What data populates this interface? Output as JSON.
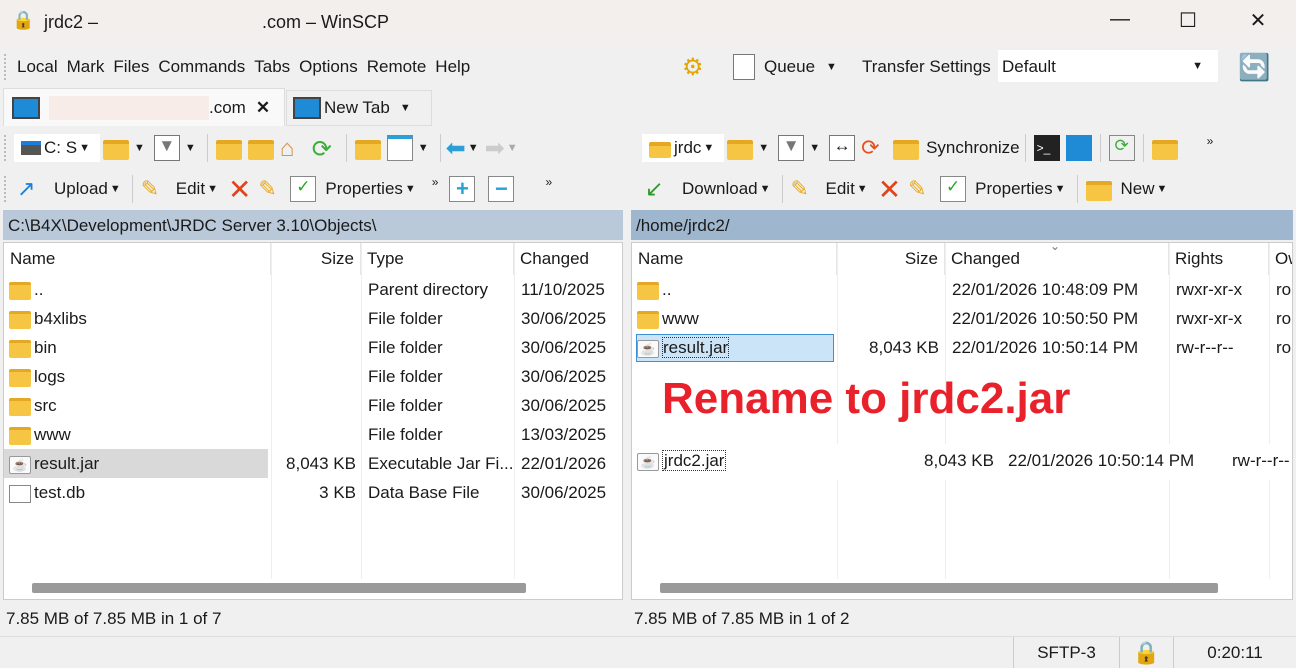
{
  "title": {
    "prefix": "jrdc2 –",
    "suffix": ".com – WinSCP"
  },
  "menu": [
    "Local",
    "Mark",
    "Files",
    "Commands",
    "Tabs",
    "Options",
    "Remote",
    "Help"
  ],
  "toolbar": {
    "queue": "Queue",
    "transfer_settings": "Transfer Settings",
    "transfer_value": "Default"
  },
  "tabs": {
    "session_suffix": ".com",
    "new_tab": "New Tab"
  },
  "left": {
    "drive": "C: S",
    "upload": "Upload",
    "edit": "Edit",
    "properties": "Properties",
    "path": "C:\\B4X\\Development\\JRDC Server 3.10\\Objects\\",
    "headers": [
      "Name",
      "Size",
      "Type",
      "Changed"
    ],
    "rows": [
      {
        "name": "..",
        "size": "",
        "type": "Parent directory",
        "changed": "11/10/2025",
        "icon": "parent"
      },
      {
        "name": "b4xlibs",
        "size": "",
        "type": "File folder",
        "changed": "30/06/2025",
        "icon": "folder"
      },
      {
        "name": "bin",
        "size": "",
        "type": "File folder",
        "changed": "30/06/2025",
        "icon": "folder"
      },
      {
        "name": "logs",
        "size": "",
        "type": "File folder",
        "changed": "30/06/2025",
        "icon": "folder"
      },
      {
        "name": "src",
        "size": "",
        "type": "File folder",
        "changed": "30/06/2025",
        "icon": "folder"
      },
      {
        "name": "www",
        "size": "",
        "type": "File folder",
        "changed": "13/03/2025",
        "icon": "folder"
      },
      {
        "name": "result.jar",
        "size": "8,043 KB",
        "type": "Executable Jar Fi...",
        "changed": "22/01/2026",
        "icon": "jar"
      },
      {
        "name": "test.db",
        "size": "3 KB",
        "type": "Data Base File",
        "changed": "30/06/2025",
        "icon": "file"
      }
    ],
    "status": "7.85 MB of 7.85 MB in 1 of 7"
  },
  "right": {
    "dir": "jrdc",
    "download": "Download",
    "edit": "Edit",
    "properties": "Properties",
    "new": "New",
    "synchronize": "Synchronize",
    "path": "/home/jrdc2/",
    "headers": [
      "Name",
      "Size",
      "Changed",
      "Rights",
      "Ow"
    ],
    "rows": [
      {
        "name": "..",
        "size": "",
        "changed": "22/01/2026 10:48:09 PM",
        "rights": "rwxr-xr-x",
        "owner": "ro",
        "icon": "parent"
      },
      {
        "name": "www",
        "size": "",
        "changed": "22/01/2026 10:50:50 PM",
        "rights": "rwxr-xr-x",
        "owner": "ro",
        "icon": "folder"
      },
      {
        "name": "result.jar",
        "size": "8,043 KB",
        "changed": "22/01/2026 10:50:14 PM",
        "rights": "rw-r--r--",
        "owner": "ro",
        "icon": "jar"
      }
    ],
    "renamed": {
      "name": "jrdc2.jar",
      "size": "8,043 KB",
      "changed": "22/01/2026 10:50:14 PM",
      "rights": "rw-r--r--"
    },
    "status": "7.85 MB of 7.85 MB in 1 of 2"
  },
  "annotation": "Rename to jrdc2.jar",
  "statusbar": {
    "protocol": "SFTP-3",
    "time": "0:20:11"
  }
}
